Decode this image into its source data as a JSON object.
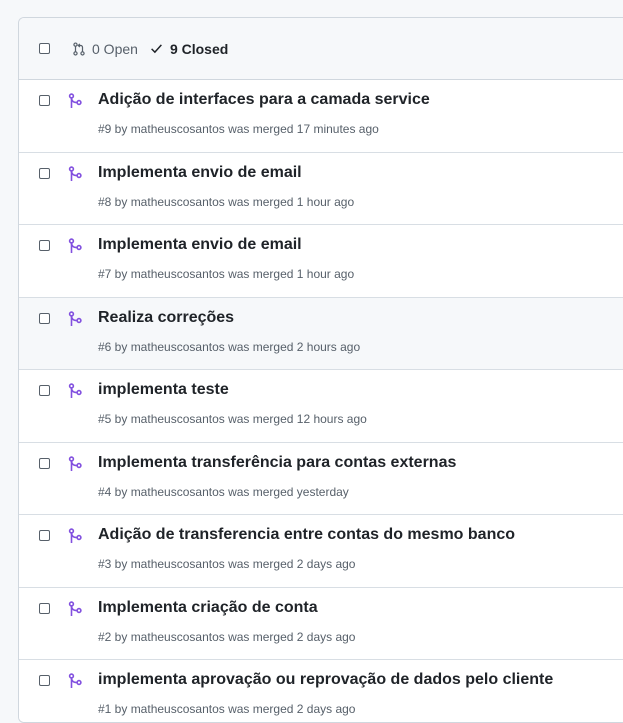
{
  "header": {
    "open_label": "0 Open",
    "closed_label": "9 Closed"
  },
  "colors": {
    "merged": "#8250df",
    "muted": "#57606a",
    "border": "#d0d7de"
  },
  "pull_requests": [
    {
      "title": "Adição de interfaces para a camada service",
      "meta": "#9 by matheuscosantos was merged 17 minutes ago",
      "hover": false
    },
    {
      "title": "Implementa envio de email",
      "meta": "#8 by matheuscosantos was merged 1 hour ago",
      "hover": false
    },
    {
      "title": "Implementa envio de email",
      "meta": "#7 by matheuscosantos was merged 1 hour ago",
      "hover": false
    },
    {
      "title": "Realiza correções",
      "meta": "#6 by matheuscosantos was merged 2 hours ago",
      "hover": true
    },
    {
      "title": "implementa teste",
      "meta": "#5 by matheuscosantos was merged 12 hours ago",
      "hover": false
    },
    {
      "title": "Implementa transferência para contas externas",
      "meta": "#4 by matheuscosantos was merged yesterday",
      "hover": false
    },
    {
      "title": "Adição de transferencia entre contas do mesmo banco",
      "meta": "#3 by matheuscosantos was merged 2 days ago",
      "hover": false
    },
    {
      "title": "Implementa criação de conta",
      "meta": "#2 by matheuscosantos was merged 2 days ago",
      "hover": false
    },
    {
      "title": "implementa aprovação ou reprovação de dados pelo cliente",
      "meta": "#1 by matheuscosantos was merged 2 days ago",
      "hover": false
    }
  ]
}
